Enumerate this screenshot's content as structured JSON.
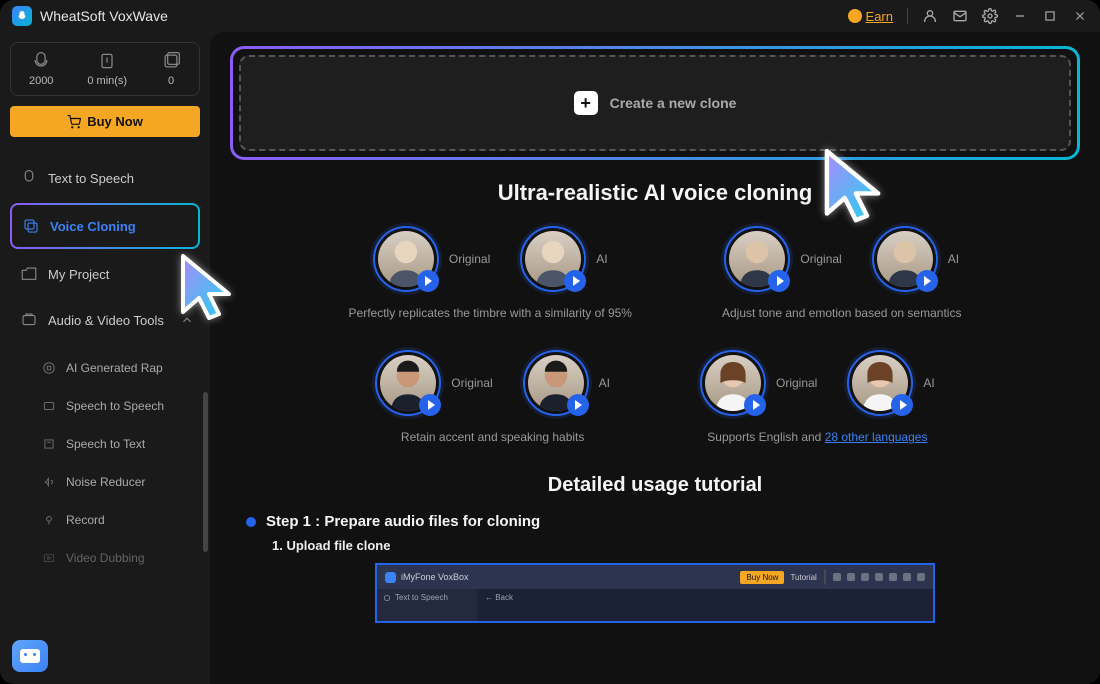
{
  "app": {
    "title": "WheatSoft VoxWave"
  },
  "titlebar": {
    "earn": "Earn"
  },
  "stats": {
    "credits": "2000",
    "minutes": "0 min(s)",
    "count": "0"
  },
  "buy_now": "Buy Now",
  "nav": {
    "tts": "Text to Speech",
    "voice_cloning": "Voice Cloning",
    "my_project": "My Project",
    "tools_header": "Audio & Video Tools",
    "sub": {
      "rap": "AI Generated Rap",
      "sts": "Speech to Speech",
      "stt": "Speech to Text",
      "noise": "Noise Reducer",
      "record": "Record",
      "dubbing": "Video Dubbing"
    }
  },
  "main": {
    "create_clone": "Create a new clone",
    "section_title": "Ultra-realistic AI voice cloning",
    "labels": {
      "original": "Original",
      "ai": "AI"
    },
    "desc1": "Perfectly replicates the timbre with a similarity of 95%",
    "desc2": "Adjust tone and emotion based on semantics",
    "desc3": "Retain accent and speaking habits",
    "desc4_prefix": "Supports English and ",
    "desc4_link": "28 other languages",
    "tutorial_title": "Detailed usage tutorial",
    "step1": "Step 1 : Prepare audio files for cloning",
    "substep1": "1.  Upload file clone"
  },
  "tutorial_shot": {
    "app": "iMyFone VoxBox",
    "buy": "Buy Now",
    "tutorial": "Tutorial",
    "nav": "Text to Speech",
    "back": "← Back"
  }
}
